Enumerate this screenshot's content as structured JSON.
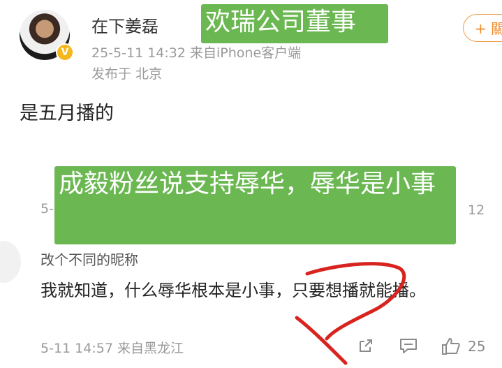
{
  "post": {
    "username": "在下姜磊",
    "timestamp": "25-5-11 14:32",
    "source": "来自iPhone客户端",
    "location": "发布于 北京",
    "follow_label": "+ 關",
    "text": "是五月播的"
  },
  "overlay": {
    "caption1": "欢瑞公司董事",
    "caption2": "成毅粉丝说支持辱华，辱华是小事"
  },
  "comment_partial": {
    "date_fragment": "5-",
    "like_count": "12"
  },
  "comment": {
    "username": "改个不同的昵称",
    "text": "我就知道，什么辱华根本是小事，只要想播就能播。",
    "date": "5-11 14:57",
    "source": "来自黑龙江",
    "like_count": "25"
  },
  "icons": [
    "verified-badge-icon",
    "share-icon",
    "comment-icon",
    "like-icon"
  ],
  "colors": {
    "caption_bg": "#6bb852",
    "follow_orange": "#f28a2a",
    "verified_gold": "#f4b71c",
    "annotation_red": "#d8231f"
  }
}
